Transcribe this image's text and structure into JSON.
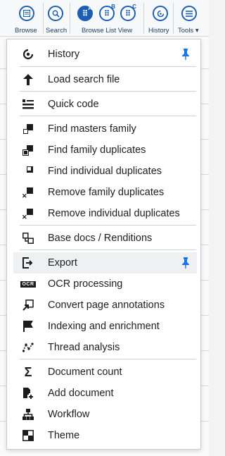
{
  "toolbar": {
    "browse": "Browse",
    "search": "Search",
    "browse_list_view": "Browse List View",
    "blv_a": "A",
    "blv_b": "B",
    "blv_c": "C",
    "history": "History",
    "tools": "Tools",
    "tools_caret": "▾"
  },
  "menu": {
    "items": [
      {
        "label": "History",
        "icon": "history-icon",
        "pinned": true
      },
      {
        "label": "Load search file",
        "icon": "arrow-up-icon"
      },
      {
        "label": "Quick code",
        "icon": "quick-code-icon"
      },
      {
        "label": "Find masters family",
        "icon": "masters-family-icon"
      },
      {
        "label": "Find family duplicates",
        "icon": "family-duplicates-icon"
      },
      {
        "label": "Find individual duplicates",
        "icon": "individual-duplicates-icon"
      },
      {
        "label": "Remove family duplicates",
        "icon": "remove-family-duplicates-icon"
      },
      {
        "label": "Remove individual duplicates",
        "icon": "remove-individual-duplicates-icon"
      },
      {
        "label": "Base docs / Renditions",
        "icon": "base-docs-icon"
      },
      {
        "label": "Export",
        "icon": "export-icon",
        "pinned": true,
        "highlighted": true
      },
      {
        "label": "OCR processing",
        "icon": "ocr-icon",
        "badge": "OCR"
      },
      {
        "label": "Convert page annotations",
        "icon": "convert-annotations-icon"
      },
      {
        "label": "Indexing and enrichment",
        "icon": "flag-icon"
      },
      {
        "label": "Thread analysis",
        "icon": "thread-analysis-icon"
      },
      {
        "label": "Document count",
        "icon": "sigma-icon"
      },
      {
        "label": "Add document",
        "icon": "add-document-icon"
      },
      {
        "label": "Workflow",
        "icon": "workflow-icon"
      },
      {
        "label": "Theme",
        "icon": "theme-icon"
      }
    ]
  },
  "colors": {
    "accent": "#1a5fb4",
    "pin": "#1a73e8",
    "highlight": "#eef0f2"
  }
}
